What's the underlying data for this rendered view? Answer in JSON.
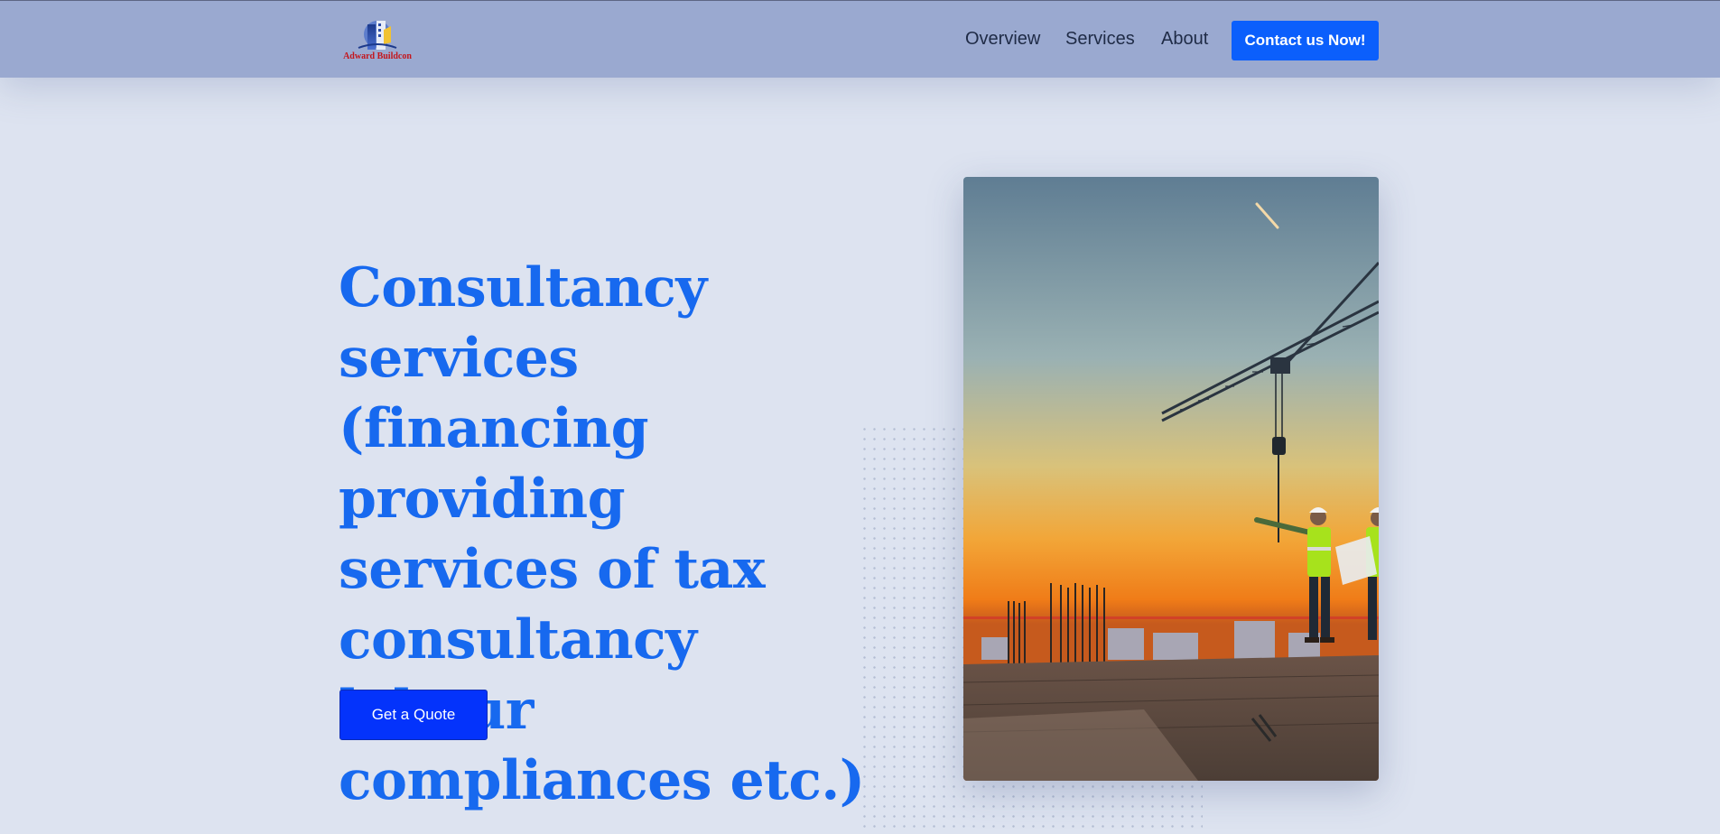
{
  "brand": {
    "logo_text": "Adward Buildcon",
    "colors": {
      "nav_bg": "#9aa9d0",
      "accent": "#0b5ffc",
      "title": "#1769ef",
      "cta": "#0433fb",
      "logo_red": "#c4161c"
    }
  },
  "nav": {
    "links": [
      {
        "label": "Overview"
      },
      {
        "label": "Services"
      },
      {
        "label": "About"
      }
    ],
    "cta_label": "Contact us Now!"
  },
  "hero": {
    "title": "Consultancy services (financing providing services of tax consultancy labour compliances etc.)",
    "button_label": "Get a Quote",
    "image_subject": "construction site at sunset with tower crane and workers"
  }
}
